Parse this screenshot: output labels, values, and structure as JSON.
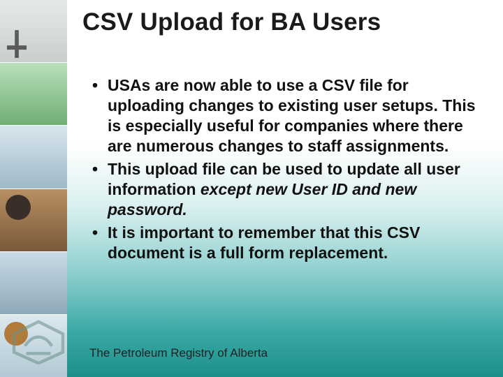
{
  "title": "CSV Upload for BA Users",
  "bullets": [
    {
      "pre": "USAs are now  able to use a CSV file for uploading changes to existing user setups. This is especially useful for companies where there are numerous changes to staff assignments.",
      "ital": "",
      "post": ""
    },
    {
      "pre": "This upload file can be used to update all user information ",
      "ital": "except new User ID and new password.",
      "post": ""
    },
    {
      "pre": "It is important to remember that this CSV document is a full form replacement.",
      "ital": "",
      "post": ""
    }
  ],
  "footer": "The Petroleum Registry of Alberta"
}
